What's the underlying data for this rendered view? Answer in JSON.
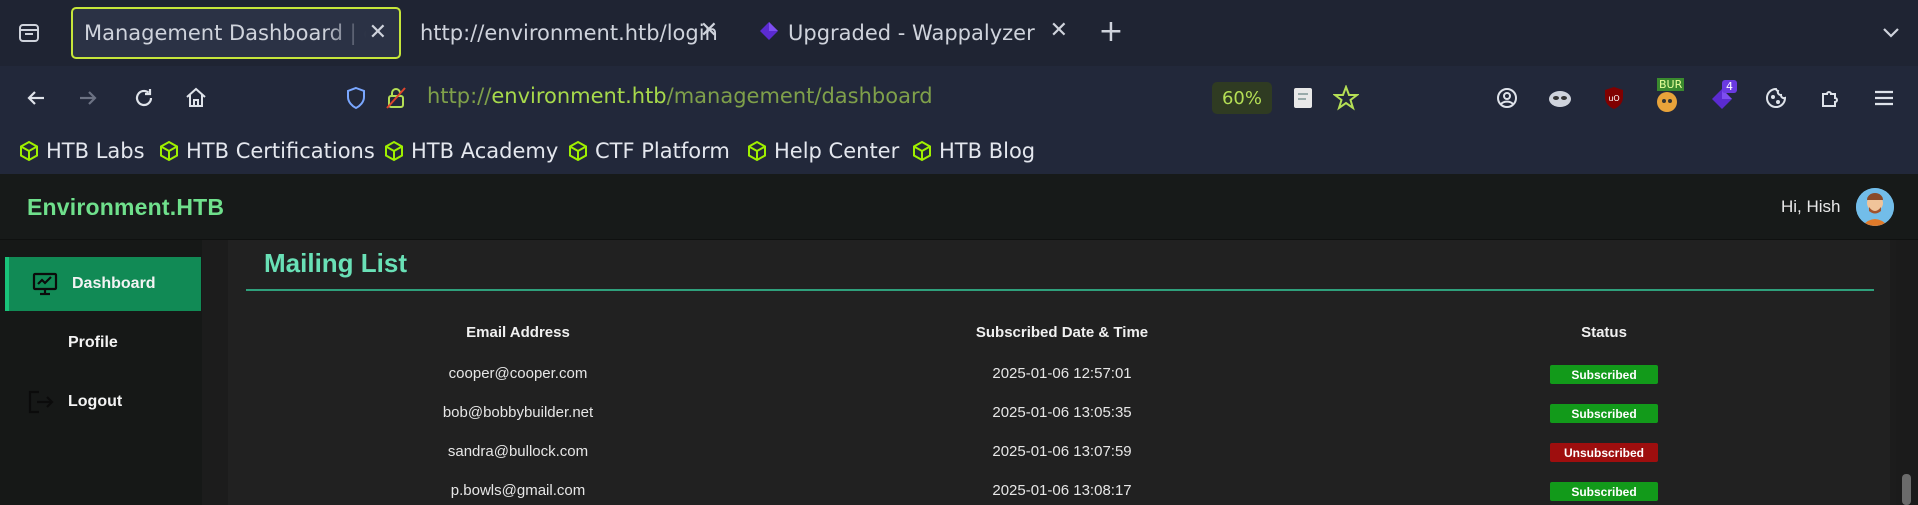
{
  "browser": {
    "tabs": [
      {
        "label": "Management Dashboard | en",
        "active": true
      },
      {
        "label": "http://environment.htb/login",
        "active": false
      },
      {
        "label": "Upgraded - Wappalyzer",
        "active": false
      }
    ],
    "url": {
      "prefix": "http://",
      "host": "environment.htb",
      "path": "/management/dashboard"
    },
    "zoom": "60%",
    "extensions": {
      "burp_badge": "BUR",
      "wappalyzer_count": "4"
    },
    "bookmarks": [
      "HTB Labs",
      "HTB Certifications",
      "HTB Academy",
      "CTF Platform",
      "Help Center",
      "HTB Blog"
    ],
    "colors": {
      "accent": "#c6e63a",
      "url_host": "#a7d94b"
    }
  },
  "app": {
    "brand": "Environment.HTB",
    "greeting": "Hi, Hish",
    "sidebar": [
      {
        "label": "Dashboard",
        "icon": "monitor-icon",
        "active": true
      },
      {
        "label": "Profile",
        "icon": "",
        "active": false
      },
      {
        "label": "Logout",
        "icon": "logout-icon",
        "active": false
      }
    ],
    "mailing_list": {
      "title": "Mailing List",
      "columns": [
        "Email Address",
        "Subscribed Date & Time",
        "Status"
      ],
      "rows": [
        {
          "email": "cooper@cooper.com",
          "date": "2025-01-06 12:57:01",
          "status": "Subscribed"
        },
        {
          "email": "bob@bobbybuilder.net",
          "date": "2025-01-06 13:05:35",
          "status": "Subscribed"
        },
        {
          "email": "sandra@bullock.com",
          "date": "2025-01-06 13:07:59",
          "status": "Unsubscribed"
        },
        {
          "email": "p.bowls@gmail.com",
          "date": "2025-01-06 13:08:17",
          "status": "Subscribed"
        }
      ]
    },
    "colors": {
      "brand": "#6fe08c",
      "sidebar_active": "#118a55",
      "subscribed": "#129a1a",
      "unsubscribed": "#9e0e0e"
    }
  }
}
